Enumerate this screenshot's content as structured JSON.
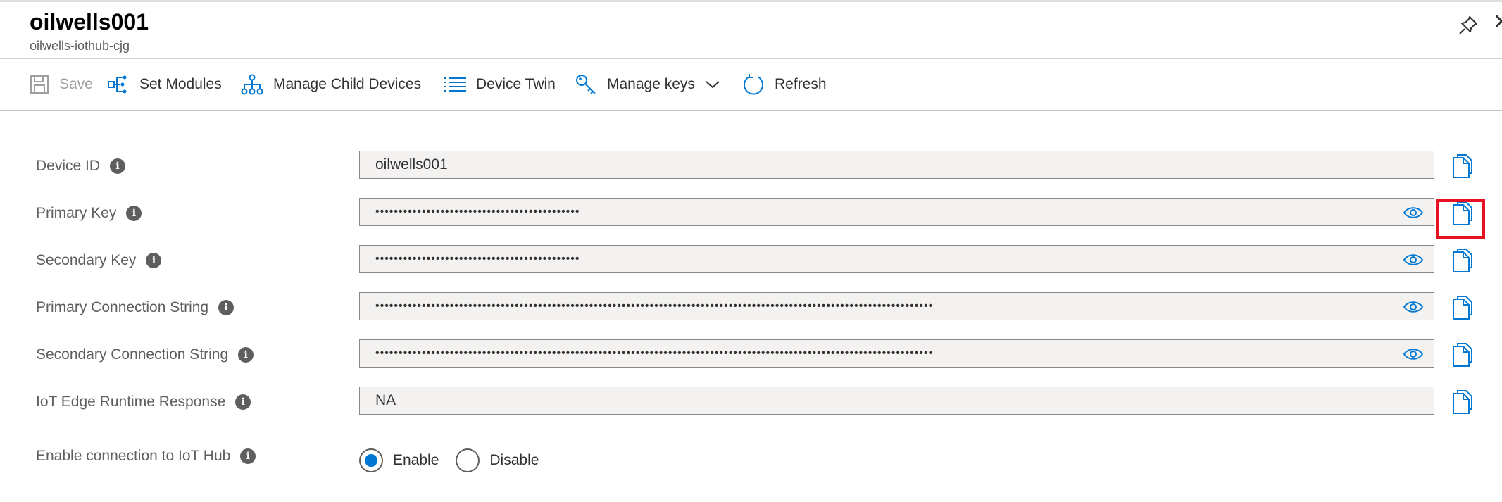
{
  "header": {
    "title": "oilwells001",
    "subtitle": "oilwells-iothub-cjg"
  },
  "toolbar": {
    "save_label": "Save",
    "set_modules_label": "Set Modules",
    "manage_child_devices_label": "Manage Child Devices",
    "device_twin_label": "Device Twin",
    "manage_keys_label": "Manage keys",
    "refresh_label": "Refresh"
  },
  "fields": [
    {
      "label": "Device ID",
      "value": "oilwells001"
    },
    {
      "label": "Primary Key",
      "value": "••••••••••••••••••••••••••••••••••••••••••••"
    },
    {
      "label": "Secondary Key",
      "value": "••••••••••••••••••••••••••••••••••••••••••••"
    },
    {
      "label": "Primary Connection String",
      "value": "••••••••••••••••••••••••••••••••••••••••••••••••••••••••••••••••••••••••••••••••••••••••••••••••••••••••••••••••••••••••"
    },
    {
      "label": "Secondary Connection String",
      "value": "••••••••••••••••••••••••••••••••••••••••••••••••••••••••••••••••••••••••••••••••••••••••••••••••••••••••••••••••••••••••"
    },
    {
      "label": "IoT Edge Runtime Response",
      "value": "NA"
    }
  ],
  "connection": {
    "label": "Enable connection to IoT Hub",
    "enable_label": "Enable",
    "disable_label": "Disable",
    "selected": "Enable"
  },
  "colors": {
    "accent": "#0078d4",
    "highlight": "#e81123"
  }
}
